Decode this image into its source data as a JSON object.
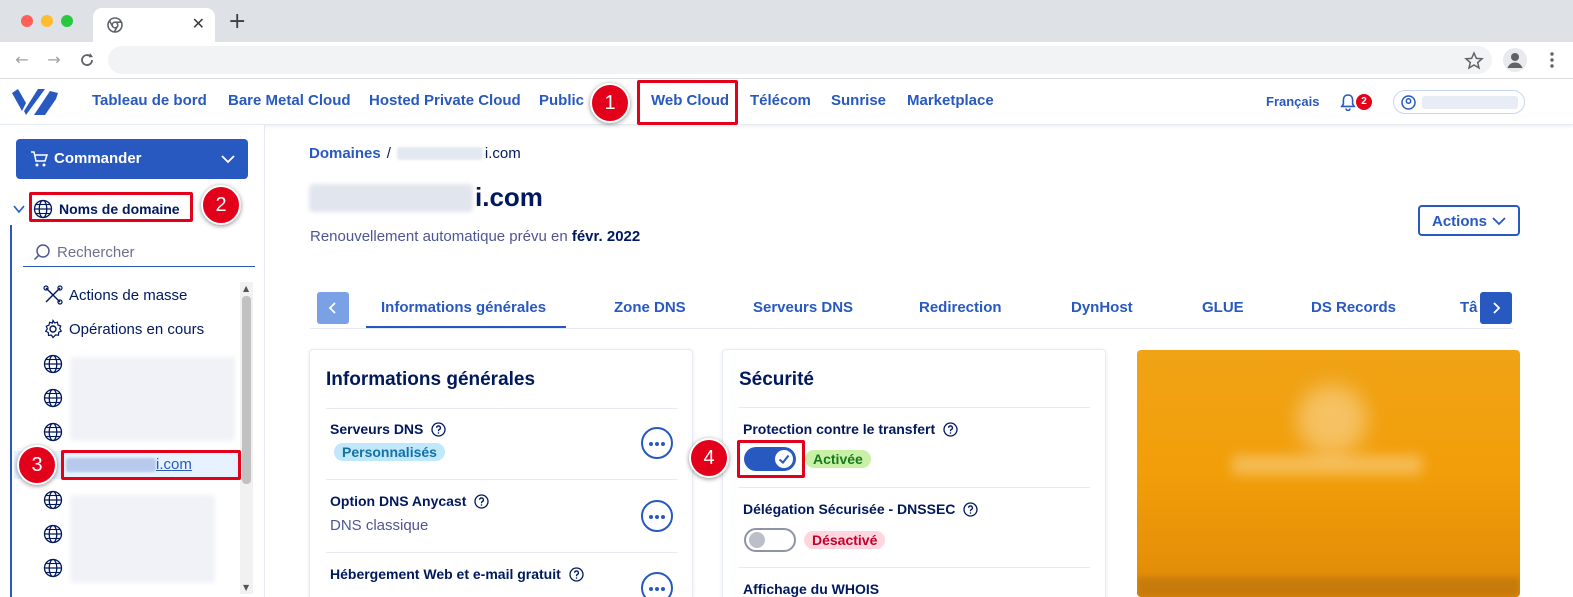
{
  "browser": {
    "tab_close": "✕",
    "new_tab": "+"
  },
  "topnav": {
    "links": [
      "Tableau de bord",
      "Bare Metal Cloud",
      "Hosted Private Cloud",
      "Public",
      "Web Cloud",
      "Télécom",
      "Sunrise",
      "Marketplace"
    ],
    "language": "Français",
    "notifications_count": "2"
  },
  "sidebar": {
    "order_label": "Commander",
    "domains_label": "Noms de domaine",
    "search_placeholder": "Rechercher",
    "mass_actions": "Actions de masse",
    "ongoing_operations": "Opérations en cours",
    "selected_domain_suffix": "i.com"
  },
  "main": {
    "breadcrumb_root": "Domaines",
    "breadcrumb_sep": "/",
    "breadcrumb_domain_suffix": "i.com",
    "title_suffix": "i.com",
    "renewal_prefix": "Renouvellement automatique prévu en",
    "renewal_date": "févr. 2022",
    "actions_label": "Actions",
    "tabs": [
      "Informations générales",
      "Zone DNS",
      "Serveurs DNS",
      "Redirection",
      "DynHost",
      "GLUE",
      "DS Records",
      "Tâ"
    ]
  },
  "general_card": {
    "title": "Informations générales",
    "dns_servers_label": "Serveurs DNS",
    "dns_servers_badge": "Personnalisés",
    "anycast_label": "Option DNS Anycast",
    "anycast_value": "DNS classique",
    "hosting_label": "Hébergement Web et e-mail gratuit"
  },
  "security_card": {
    "title": "Sécurité",
    "transfer_label": "Protection contre le transfert",
    "transfer_status": "Activée",
    "transfer_enabled": true,
    "dnssec_label": "Délégation Sécurisée - DNSSEC",
    "dnssec_status": "Désactivé",
    "dnssec_enabled": false,
    "whois_label": "Affichage du WHOIS"
  },
  "annotations": [
    "1",
    "2",
    "3",
    "4"
  ],
  "colors": {
    "primary": "#2859c0",
    "navy": "#00185e",
    "highlight": "#e2001a",
    "success_bg": "#c9f0a7",
    "error_bg": "#ffd6dd",
    "info_bg": "#bfe8fb",
    "promo": "#f29e09"
  }
}
